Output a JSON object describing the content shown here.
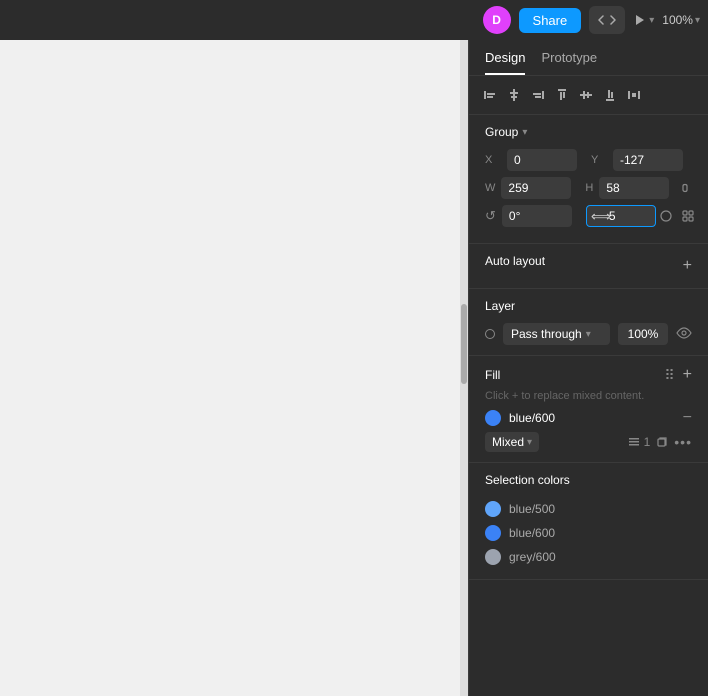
{
  "topbar": {
    "avatar_letter": "D",
    "share_label": "Share",
    "zoom_label": "100%"
  },
  "tabs": {
    "design_label": "Design",
    "prototype_label": "Prototype"
  },
  "alignment": {
    "icons": [
      "align-left",
      "align-center-h",
      "align-right",
      "align-top",
      "align-center-v",
      "align-bottom",
      "distribute"
    ]
  },
  "group": {
    "title": "Group",
    "x_label": "X",
    "x_value": "0",
    "y_label": "Y",
    "y_value": "-127",
    "w_label": "W",
    "w_value": "259",
    "h_label": "H",
    "h_value": "58",
    "rotation_label": "↺",
    "rotation_value": "0°",
    "corner_value": "5"
  },
  "auto_layout": {
    "title": "Auto layout"
  },
  "layer": {
    "title": "Layer",
    "mode": "Pass through",
    "opacity": "100%"
  },
  "fill": {
    "title": "Fill",
    "hint": "Click + to replace mixed content.",
    "items": [
      {
        "color": "#3b82f6",
        "name": "blue/600"
      }
    ],
    "mixed_label": "Mixed",
    "count_label": "1"
  },
  "selection_colors": {
    "title": "Selection colors",
    "items": [
      {
        "color": "#60a5fa",
        "name": "blue/500"
      },
      {
        "color": "#3b82f6",
        "name": "blue/600"
      },
      {
        "color": "#9ca3af",
        "name": "grey/600"
      }
    ]
  }
}
